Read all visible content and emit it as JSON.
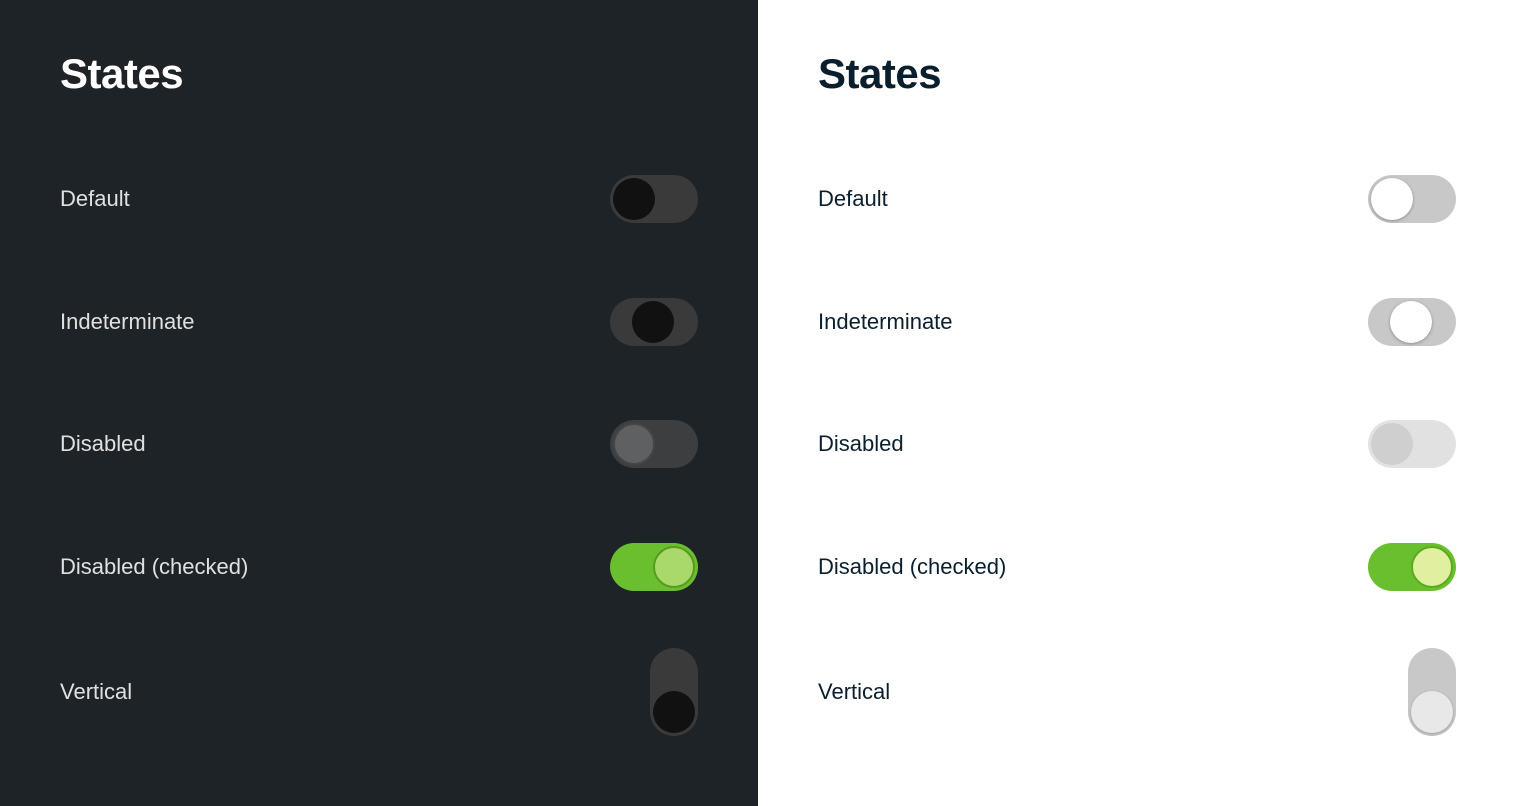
{
  "dark_panel": {
    "title": "States",
    "states": [
      {
        "id": "default",
        "label": "Default"
      },
      {
        "id": "indeterminate",
        "label": "Indeterminate"
      },
      {
        "id": "disabled",
        "label": "Disabled"
      },
      {
        "id": "disabled-checked",
        "label": "Disabled (checked)"
      },
      {
        "id": "vertical",
        "label": "Vertical"
      }
    ]
  },
  "light_panel": {
    "title": "States",
    "states": [
      {
        "id": "default",
        "label": "Default"
      },
      {
        "id": "indeterminate",
        "label": "Indeterminate"
      },
      {
        "id": "disabled",
        "label": "Disabled"
      },
      {
        "id": "disabled-checked",
        "label": "Disabled (checked)"
      },
      {
        "id": "vertical",
        "label": "Vertical"
      }
    ]
  }
}
